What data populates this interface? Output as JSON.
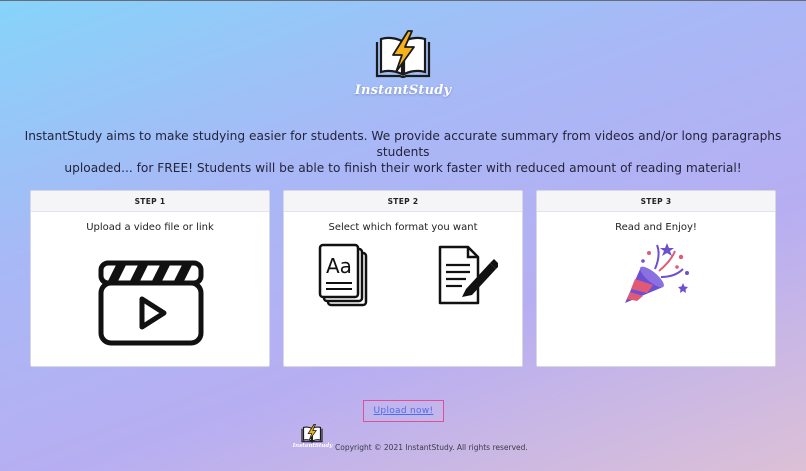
{
  "brand": {
    "name": "InstantStudy"
  },
  "intro": {
    "line1": "InstantStudy aims to make studying easier for students. We provide accurate summary from videos and/or long paragraphs students",
    "line2": "uploaded... for FREE! Students will be able to finish their work faster with reduced amount of reading material!"
  },
  "steps": [
    {
      "label": "STEP 1",
      "text": "Upload a video file or link",
      "icons": [
        "video-clapper-icon"
      ]
    },
    {
      "label": "STEP 2",
      "text": "Select which format you want",
      "icons": [
        "flashcards-icon",
        "document-edit-icon"
      ]
    },
    {
      "label": "STEP 3",
      "text": "Read and Enjoy!",
      "icons": [
        "party-popper-icon"
      ]
    }
  ],
  "upload_button": {
    "label": "Upload now!"
  },
  "footer": {
    "brand": "InstantStudy",
    "copyright": "Copyright © 2021 InstantStudy. All rights reserved."
  },
  "colors": {
    "accent_link": "#4a6ee8",
    "button_border": "#e0509a",
    "logo_bolt": "#f6b21a"
  }
}
